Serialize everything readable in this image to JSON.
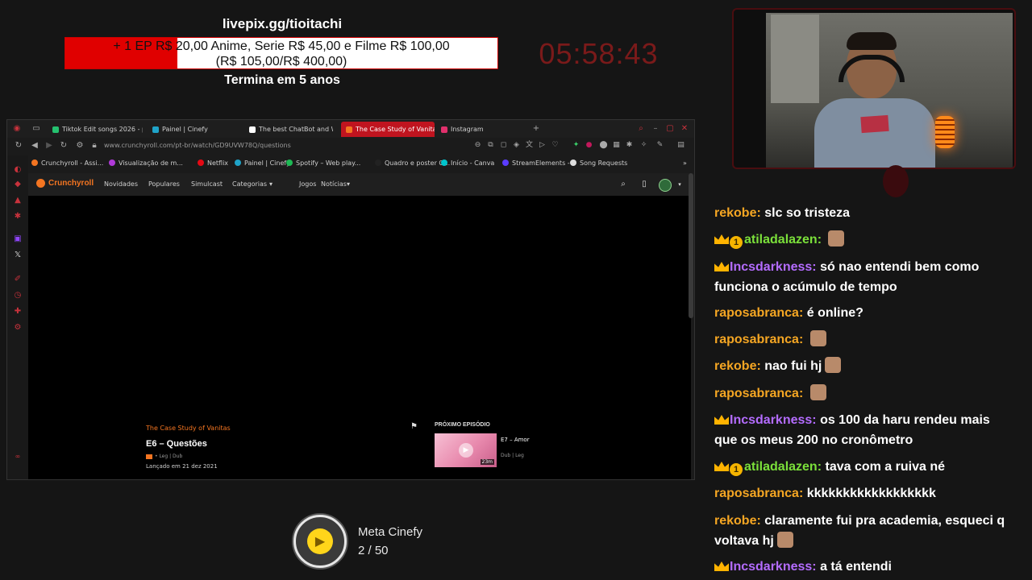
{
  "donation": {
    "url": "livepix.gg/tioitachi",
    "line1": "+ 1 EP R$ 20,00 Anime, Serie R$ 45,00 e Filme R$ 100,00",
    "line2": "(R$ 105,00/R$ 400,00)",
    "progress_fraction": 0.26,
    "ends_label": "Termina em 5 anos",
    "timer": "05:58:43"
  },
  "browser": {
    "tabs": [
      {
        "label": "Tiktok Edit songs 2026 - p",
        "active": false,
        "color": "#25c16f"
      },
      {
        "label": "Painel | Cinefy",
        "active": false,
        "color": "#1fa3c8"
      },
      {
        "label": "The best ChatBot and Wi",
        "active": false,
        "color": "#ffffff"
      },
      {
        "label": "The Case Study of Vanitas",
        "active": true,
        "color": "#f47521"
      },
      {
        "label": "Instagram",
        "active": false,
        "color": "#e1306c"
      }
    ],
    "url": "www.crunchyroll.com/pt-br/watch/GD9UVW78Q/questions",
    "bookmarks": [
      {
        "label": "Crunchyroll - Assi...",
        "color": "#f47521"
      },
      {
        "label": "Visualização de m...",
        "color": "#b03ad8"
      },
      {
        "label": "Netflix",
        "color": "#e50914"
      },
      {
        "label": "Painel | Cinefy",
        "color": "#1fa3c8"
      },
      {
        "label": "Spotify – Web play...",
        "color": "#1db954"
      },
      {
        "label": "Quadro e poster G...",
        "color": "#222222"
      },
      {
        "label": "Início - Canva",
        "color": "#00c4cc"
      },
      {
        "label": "StreamElements -",
        "color": "#5a3cff"
      },
      {
        "label": "Song Requests",
        "color": "#dddddd"
      }
    ]
  },
  "site": {
    "logo": "Crunchyroll",
    "nav": [
      "Novidades",
      "Populares",
      "Simulcast",
      "Categorias",
      "Jogos",
      "Notícias"
    ],
    "series": "The Case Study of Vanitas",
    "episode_title": "E6 – Questões",
    "episode_meta": "• Leg | Dub",
    "release": "Lançado em 21 dez 2021",
    "next_label": "PRÓXIMO EPISÓDIO",
    "next_title": "E7 – Amor",
    "next_meta": "Dub | Leg",
    "next_duration": "23m"
  },
  "goal": {
    "title": "Meta Cinefy",
    "count": "2 / 50"
  },
  "chat": [
    {
      "user": "rekobe:",
      "text": "slc so tristeza",
      "color": "#f5a623",
      "crown": false,
      "sub": false,
      "emote": false
    },
    {
      "user": "atiladalazen:",
      "text": "",
      "color": "#7be03a",
      "crown": true,
      "sub": true,
      "emote": true
    },
    {
      "user": "Incsdarkness:",
      "text": "só nao entendi bem como funciona o acúmulo de tempo",
      "color": "#b46cff",
      "crown": true,
      "sub": false,
      "emote": false
    },
    {
      "user": "raposabranca:",
      "text": "é online?",
      "color": "#f5a623",
      "crown": false,
      "sub": false,
      "emote": false
    },
    {
      "user": "raposabranca:",
      "text": "",
      "color": "#f5a623",
      "crown": false,
      "sub": false,
      "emote": true
    },
    {
      "user": "rekobe:",
      "text": "nao fui hj",
      "color": "#f5a623",
      "crown": false,
      "sub": false,
      "emote": true
    },
    {
      "user": "raposabranca:",
      "text": "",
      "color": "#f5a623",
      "crown": false,
      "sub": false,
      "emote": true
    },
    {
      "user": "Incsdarkness:",
      "text": "os 100 da haru rendeu mais que os meus 200 no cronômetro",
      "color": "#b46cff",
      "crown": true,
      "sub": false,
      "emote": false
    },
    {
      "user": "atiladalazen:",
      "text": "tava com a ruiva né",
      "color": "#7be03a",
      "crown": true,
      "sub": true,
      "emote": false
    },
    {
      "user": "raposabranca:",
      "text": "kkkkkkkkkkkkkkkkkk",
      "color": "#f5a623",
      "crown": false,
      "sub": false,
      "emote": false
    },
    {
      "user": "rekobe:",
      "text": "claramente fui pra academia, esqueci q voltava hj",
      "color": "#f5a623",
      "crown": false,
      "sub": false,
      "emote": true
    },
    {
      "user": "Incsdarkness:",
      "text": "a tá entendi",
      "color": "#b46cff",
      "crown": true,
      "sub": false,
      "emote": false
    }
  ]
}
